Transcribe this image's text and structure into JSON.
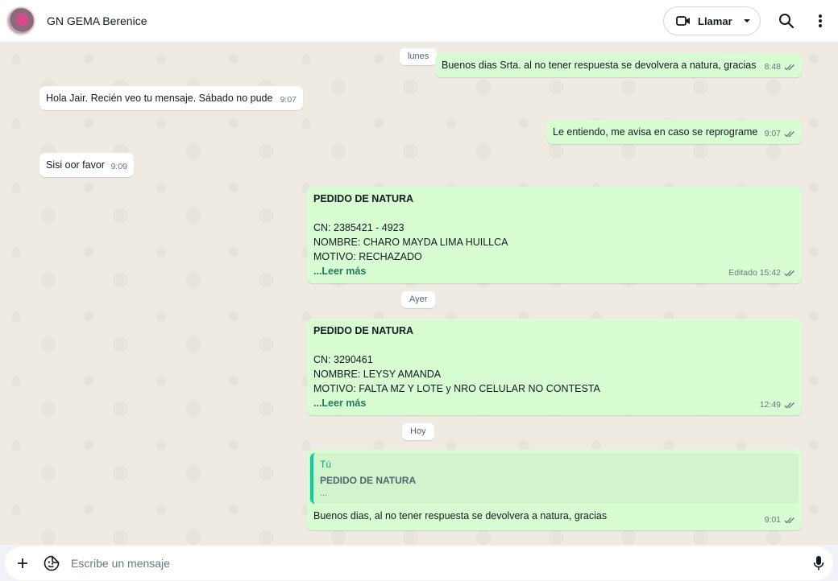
{
  "header": {
    "contact_name": "GN GEMA Berenice",
    "call_label": "Llamar"
  },
  "chat": {
    "date_chips": [
      "lunes",
      "Ayer",
      "Hoy"
    ],
    "messages": [
      {
        "text": "Buenos dias Srta. al no tener respuesta se devolvera a natura, gracias",
        "time": "8:48"
      },
      {
        "text": "Hola Jair. Recién veo tu mensaje. Sábado no pude",
        "time": "9:07"
      },
      {
        "text": "Le entiendo, me avisa en caso se reprograme",
        "time": "9:07"
      },
      {
        "text": "Sisi oor favor",
        "time": "9:09"
      },
      {
        "title": "PEDIDO DE NATURA",
        "lines": [
          "CN:  2385421 - 4923",
          "NOMBRE:  CHARO MAYDA LIMA HUILLCA",
          "MOTIVO: RECHAZADO"
        ],
        "read_more": "...Leer más",
        "time": "Editado 15:42"
      },
      {
        "title": "PEDIDO DE NATURA",
        "lines": [
          "CN:  3290461",
          "NOMBRE:  LEYSY AMANDA",
          "MOTIVO: FALTA MZ Y LOTE y NRO CELULAR NO CONTESTA"
        ],
        "read_more": "...Leer más",
        "time": "12:49"
      },
      {
        "quote_author": "Tú",
        "quote_title": "PEDIDO DE NATURA",
        "quote_snippet": "...",
        "text": "Buenos dias, al no tener respuesta se devolvera a natura, gracias",
        "time": "9:01"
      }
    ]
  },
  "composer": {
    "placeholder": "Escribe un mensaje"
  },
  "colors": {
    "outgoing_bubble": "#d9fdd3",
    "incoming_bubble": "#ffffff",
    "chat_background": "#efeae2",
    "read_ticks": "#53bdeb"
  },
  "icons": [
    "video-camera-icon",
    "chevron-down-icon",
    "search-icon",
    "more-vertical-icon",
    "double-check-icon",
    "plus-icon",
    "sticker-icon",
    "mic-icon"
  ]
}
